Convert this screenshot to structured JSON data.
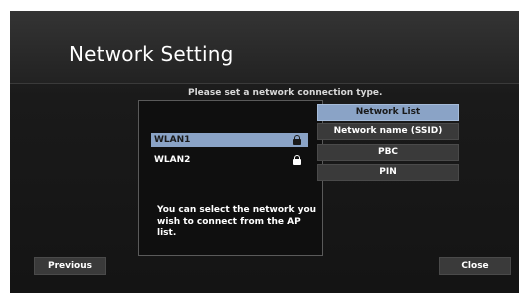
{
  "header": {
    "title": "Network Setting"
  },
  "instruction": "Please set a network connection type.",
  "networks": [
    {
      "name": "WLAN1",
      "selected": true,
      "icon": "lock-icon"
    },
    {
      "name": "WLAN2",
      "selected": false,
      "icon": "lock-icon"
    }
  ],
  "help_text": "You can select the network you wish to connect from the AP list.",
  "options": [
    {
      "label": "Network List",
      "active": true
    },
    {
      "label": "Network name (SSID)",
      "active": false
    },
    {
      "label": "PBC",
      "active": false
    },
    {
      "label": "PIN",
      "active": false
    }
  ],
  "footer": {
    "previous_label": "Previous",
    "close_label": "Close"
  },
  "colors": {
    "accent": "#8aa3c6",
    "background": "#1a1a1a",
    "button": "#3a3a3a"
  }
}
